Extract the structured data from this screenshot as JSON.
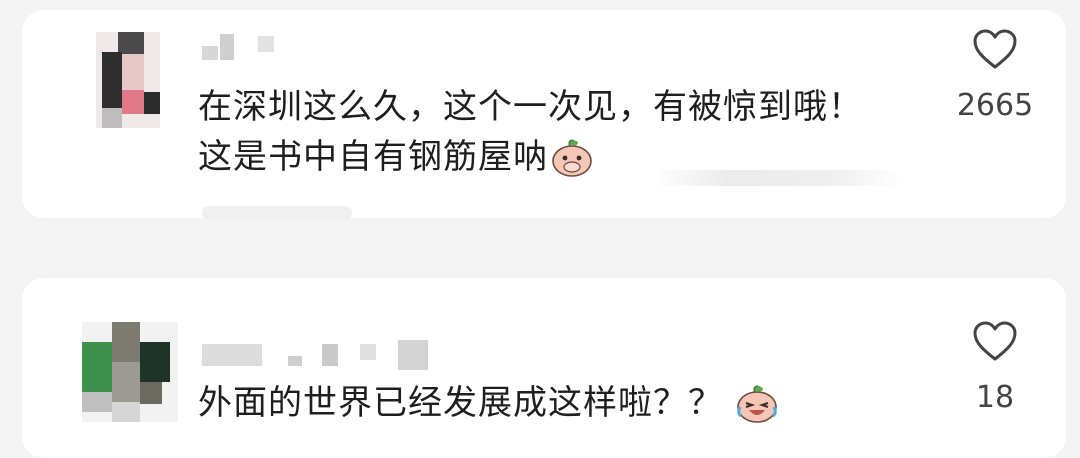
{
  "comments": [
    {
      "text_line1": "在深圳这么久，这个一次见，有被惊到哦！",
      "text_line2": "这是书中自有钢筋屋呐",
      "emoji": "covering-mouth-peach-emoji",
      "likes": "2665"
    },
    {
      "text_line1": "外面的世界已经发展成这样啦？？",
      "emoji": "crying-laughing-peach-emoji",
      "likes": "18"
    }
  ],
  "colors": {
    "background": "#f4f4f4",
    "card": "#ffffff",
    "text": "#1e1e1e",
    "count": "#444444",
    "heart": "#444444"
  }
}
